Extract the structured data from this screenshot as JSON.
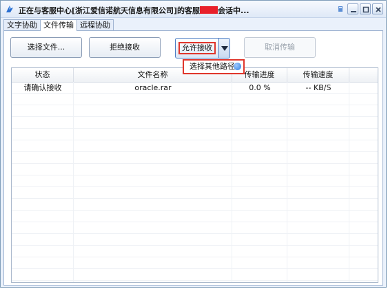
{
  "window": {
    "title_before": "正在与客服中心[浙江爱信诺航天信息有限公司]的客服",
    "title_after": "会话中...",
    "buttons": [
      "skin-icon",
      "minimize-icon",
      "maximize-icon",
      "close-icon"
    ]
  },
  "tabs": [
    {
      "label": "文字协助",
      "active": false
    },
    {
      "label": "文件传输",
      "active": true
    },
    {
      "label": "远程协助",
      "active": false
    }
  ],
  "toolbar": {
    "select_file": "选择文件...",
    "reject": "拒绝接收",
    "accept": "允许接收",
    "cancel": "取消传输"
  },
  "dropdown": {
    "item": "选择其他路径"
  },
  "table": {
    "columns": [
      "状态",
      "文件名称",
      "传输进度",
      "传输速度",
      ""
    ],
    "rows": [
      {
        "status": "请确认接收",
        "name": "oracle.rar",
        "progress": "0.0 %",
        "speed": "-- KB/S"
      }
    ]
  },
  "colors": {
    "highlight": "#e0362c",
    "accent": "#4a7cc3"
  }
}
